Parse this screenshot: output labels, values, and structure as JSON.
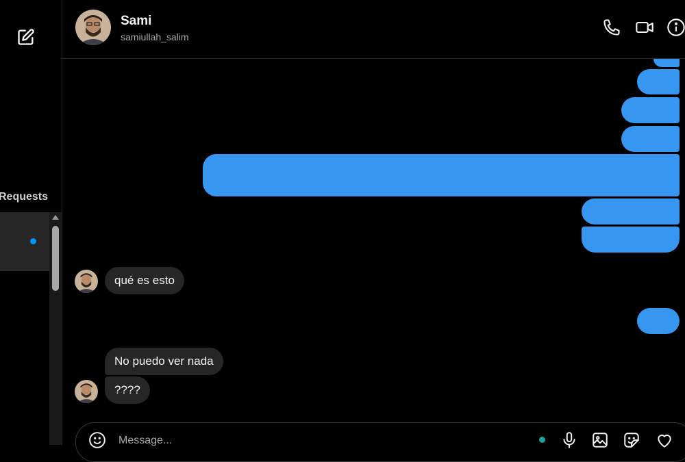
{
  "sidebar": {
    "compose_icon": "compose-icon",
    "requests_label": "Requests"
  },
  "header": {
    "name": "Sami",
    "username": "samiullah_salim",
    "icons": [
      "phone-icon",
      "video-icon",
      "info-icon"
    ]
  },
  "messages": {
    "incoming": [
      {
        "text": "qué es esto"
      },
      {
        "text": "No puedo ver nada"
      },
      {
        "text": "????"
      }
    ],
    "outgoing_blank_count": 8
  },
  "composer": {
    "placeholder": "Message...",
    "icons": [
      "emoji-icon",
      "microphone-icon",
      "image-icon",
      "sticker-icon",
      "heart-icon"
    ]
  },
  "colors": {
    "background": "#000000",
    "outgoing_bubble": "#3797f0",
    "incoming_bubble": "#262626",
    "unread_dot": "#0095f6"
  }
}
